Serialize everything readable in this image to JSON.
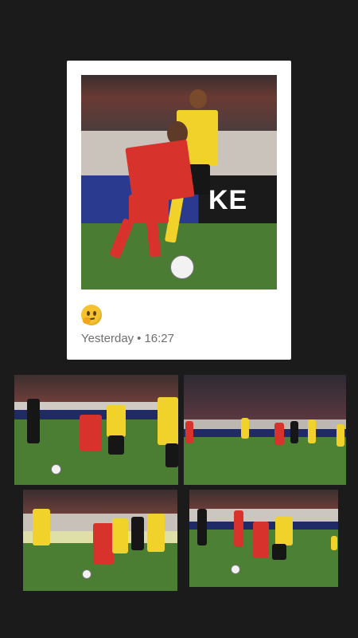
{
  "post": {
    "emoji_name": "thinking-face-emoji",
    "day": "Yesterday",
    "separator": "•",
    "time": "16:27"
  },
  "photos": [
    {
      "name": "main-photo",
      "banner_text": "KE"
    },
    {
      "name": "thumbnail-1"
    },
    {
      "name": "thumbnail-2"
    },
    {
      "name": "thumbnail-3"
    },
    {
      "name": "thumbnail-4"
    }
  ]
}
